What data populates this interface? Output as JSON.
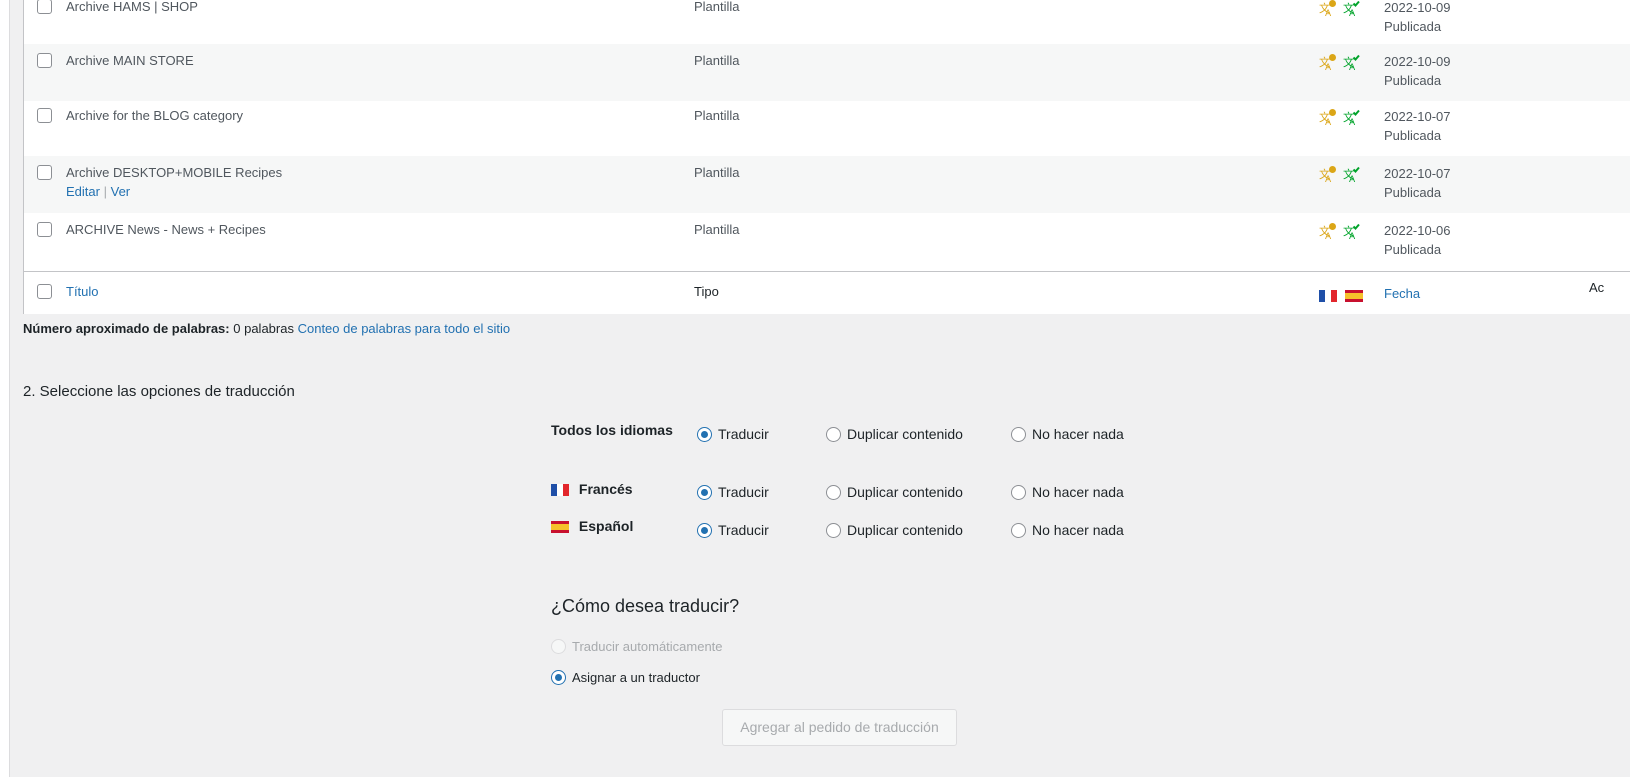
{
  "rows": [
    {
      "title": "Archive HAMS | SHOP",
      "type": "Plantilla",
      "date": "2022-10-09",
      "status": "Publicada"
    },
    {
      "title": "Archive MAIN STORE",
      "type": "Plantilla",
      "date": "2022-10-09",
      "status": "Publicada"
    },
    {
      "title": "Archive for the BLOG category",
      "type": "Plantilla",
      "date": "2022-10-07",
      "status": "Publicada"
    },
    {
      "title": "Archive DESKTOP+MOBILE Recipes",
      "type": "Plantilla",
      "date": "2022-10-07",
      "status": "Publicada",
      "actions": {
        "edit": "Editar",
        "sep": "|",
        "view": "Ver"
      }
    },
    {
      "title": "ARCHIVE News - News + Recipes",
      "type": "Plantilla",
      "date": "2022-10-06",
      "status": "Publicada"
    }
  ],
  "footer": {
    "title_col": "Título",
    "type_col": "Tipo",
    "date_col": "Fecha",
    "cut_col": "Ac"
  },
  "word_count": {
    "label": "Número aproximado de palabras:",
    "value": "0 palabras",
    "link": "Conteo de palabras para todo el sitio"
  },
  "section": {
    "title": "2. Seleccione las opciones de traducción"
  },
  "languages": [
    {
      "label": "Todos los idiomas",
      "flag": ""
    },
    {
      "label": "Francés",
      "flag": "fr"
    },
    {
      "label": "Español",
      "flag": "es"
    }
  ],
  "options": {
    "translate": "Traducir",
    "duplicate": "Duplicar contenido",
    "nothing": "No hacer nada"
  },
  "how": {
    "title": "¿Cómo desea traducir?",
    "auto": "Traducir automáticamente",
    "assign": "Asignar a un traductor"
  },
  "submit": {
    "label": "Agregar al pedido de traducción"
  },
  "colors": {
    "link": "#2271b1",
    "icon_pending": "#dba617",
    "icon_done": "#00a32a"
  },
  "icons": {
    "status_pending": "translate-pending-icon",
    "status_done": "translate-done-icon"
  }
}
